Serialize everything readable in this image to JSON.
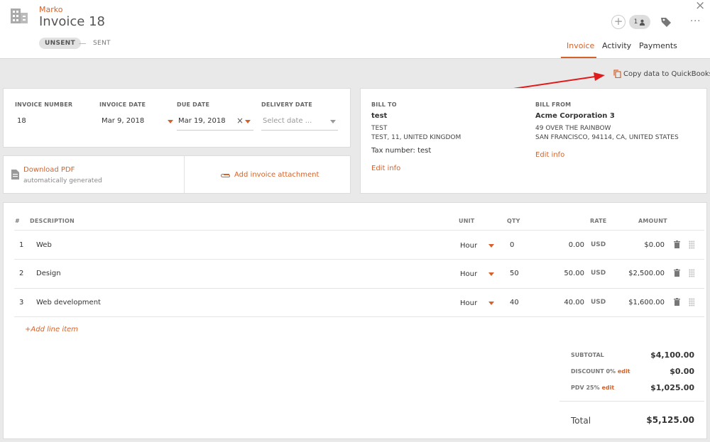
{
  "header": {
    "client": "Marko",
    "title": "Invoice 18",
    "status_unsent": "UNSENT",
    "status_sent": "SENT",
    "close_glyph": "×",
    "plus_glyph": "+",
    "user_count": "1",
    "more_glyph": "···",
    "tabs": [
      {
        "label": "Invoice"
      },
      {
        "label": "Activity"
      },
      {
        "label": "Payments"
      }
    ]
  },
  "quickbooks": {
    "label": "Copy data to QuickBooks"
  },
  "invoice_meta": {
    "number_label": "INVOICE NUMBER",
    "number_value": "18",
    "date_label": "INVOICE DATE",
    "date_value": "Mar 9, 2018",
    "due_label": "DUE DATE",
    "due_value": "Mar 19, 2018",
    "clear_glyph": "×",
    "delivery_label": "DELIVERY DATE",
    "delivery_placeholder": "Select date ..."
  },
  "pdf": {
    "download_label": "Download PDF",
    "generated_note": "automatically generated",
    "attachment_label": "Add invoice attachment"
  },
  "bill_to": {
    "label": "BILL TO",
    "name": "test",
    "line1": "TEST",
    "line2": "TEST, 11, UNITED KINGDOM",
    "tax": "Tax number: test",
    "edit": "Edit info"
  },
  "bill_from": {
    "label": "BILL FROM",
    "name": "Acme Corporation 3",
    "line1": "49 OVER THE RAINBOW",
    "line2": "SAN FRANCISCO, 94114, CA, UNITED STATES",
    "edit": "Edit info"
  },
  "items": {
    "headers": {
      "num": "#",
      "description": "DESCRIPTION",
      "unit": "UNIT",
      "qty": "QTY",
      "rate": "RATE",
      "amount": "AMOUNT"
    },
    "rows": [
      {
        "num": "1",
        "description": "Web",
        "unit": "Hour",
        "qty": "0",
        "rate": "0.00",
        "currency": "USD",
        "amount": "$0.00"
      },
      {
        "num": "2",
        "description": "Design",
        "unit": "Hour",
        "qty": "50",
        "rate": "50.00",
        "currency": "USD",
        "amount": "$2,500.00"
      },
      {
        "num": "3",
        "description": "Web development",
        "unit": "Hour",
        "qty": "40",
        "rate": "40.00",
        "currency": "USD",
        "amount": "$1,600.00"
      }
    ],
    "add_label": "+Add line item"
  },
  "totals": {
    "subtotal_label": "SUBTOTAL",
    "subtotal_value": "$4,100.00",
    "discount_label": "DISCOUNT 0%",
    "discount_edit": "edit",
    "discount_value": "$0.00",
    "tax_label": "PDV 25%",
    "tax_edit": "edit",
    "tax_value": "$1,025.00",
    "total_label": "Total",
    "total_value": "$5,125.00"
  },
  "colors": {
    "accent": "#d4622a",
    "arrow": "#e01b1b",
    "background": "#e9e9e9"
  }
}
